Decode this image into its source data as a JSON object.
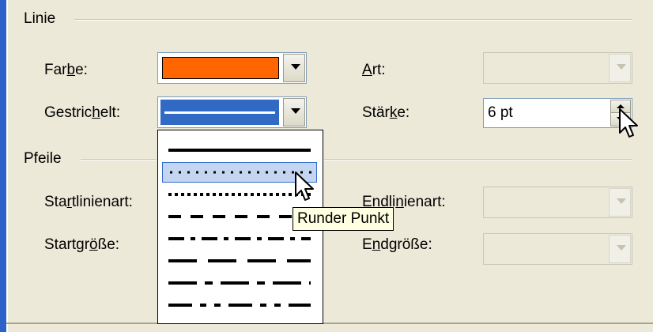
{
  "colors": {
    "line_color": "#ff6600",
    "selection": "#316ac5",
    "highlight": "#c3d5f1",
    "tooltip_bg": "#ffffe1"
  },
  "linie": {
    "title": "Linie",
    "farbe_label_pre": "Far",
    "farbe_label_u": "b",
    "farbe_label_post": "e:",
    "gestrichelt_label_pre": "Gestric",
    "gestrichelt_label_u": "h",
    "gestrichelt_label_post": "elt:",
    "art_label_u": "A",
    "art_label_post": "rt:",
    "staerke_label_pre": "Stär",
    "staerke_label_u": "k",
    "staerke_label_post": "e:",
    "staerke_value": "6 pt"
  },
  "pfeile": {
    "title": "Pfeile",
    "startlinienart_pre": "Sta",
    "startlinienart_u": "r",
    "startlinienart_post": "tlinienart:",
    "startgroesse_pre": "Startgr",
    "startgroesse_u": "ö",
    "startgroesse_post": "ße:",
    "endlinienart_pre": "Endli",
    "endlinienart_u": "n",
    "endlinienart_post": "ienart:",
    "endgroesse_pre": "E",
    "endgroesse_u": "n",
    "endgroesse_post": "dgröße:"
  },
  "dash_options": [
    {
      "name": "solid",
      "selected": false
    },
    {
      "name": "round-dot",
      "selected": true
    },
    {
      "name": "square-dot",
      "selected": false
    },
    {
      "name": "dash",
      "selected": false
    },
    {
      "name": "dash-dot",
      "selected": false
    },
    {
      "name": "long-dash",
      "selected": false
    },
    {
      "name": "long-dash-dot",
      "selected": false
    },
    {
      "name": "long-dash-dot-dot",
      "selected": false
    }
  ],
  "tooltip": "Runder Punkt"
}
